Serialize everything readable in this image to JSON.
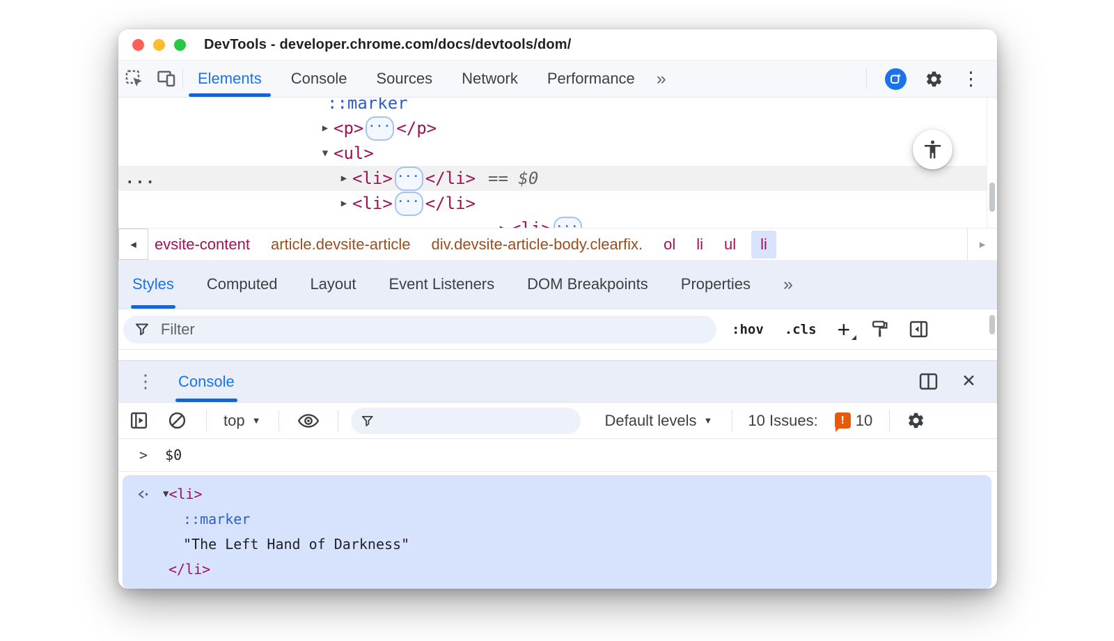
{
  "colors": {
    "accent": "#1a73e8",
    "tab_underline": "#1962d2",
    "tag_color": "#9e1355",
    "class_color": "#9a4e1f",
    "pseudo_color": "#2c5ecf",
    "issues_orange": "#e8590c",
    "selection_blue": "#d7e3fc"
  },
  "glyphs": {
    "collapsed": "▶",
    "expanded": "▼",
    "kebab": "⋮",
    "close": "✕",
    "more": "»",
    "crumb_left": "◂",
    "crumb_right": "▸",
    "prompt": ">",
    "caret_down": "▼",
    "ellipsis": "···",
    "gutter": "..."
  },
  "titlebar": {
    "title": "DevTools - developer.chrome.com/docs/devtools/dom/"
  },
  "main_tabs": {
    "items": [
      "Elements",
      "Console",
      "Sources",
      "Network",
      "Performance"
    ],
    "selected": "Elements"
  },
  "dom_tree": {
    "marker": "::marker",
    "p_open": "<p>",
    "p_close": "</p>",
    "ul_open": "<ul>",
    "li_open": "<li>",
    "li_close": "</li>",
    "selected_eq": "==",
    "selected_var": "$0"
  },
  "breadcrumbs": {
    "items": [
      "evsite-content",
      "article.devsite-article",
      "div.devsite-article-body.clearfix.",
      "ol",
      "li",
      "ul",
      "li"
    ],
    "selected_index": 6
  },
  "styles_panel": {
    "tabs": [
      "Styles",
      "Computed",
      "Layout",
      "Event Listeners",
      "DOM Breakpoints",
      "Properties"
    ],
    "selected": "Styles",
    "filter_placeholder": "Filter",
    "hov": ":hov",
    "cls": ".cls",
    "plus": "+"
  },
  "console": {
    "tab": "Console",
    "context": "top",
    "levels": "Default levels",
    "issues_label": "10 Issues:",
    "issues_count": "10",
    "echo": "$0",
    "result": {
      "open": "<li>",
      "marker": "::marker",
      "text": "\"The Left Hand of Darkness\"",
      "close": "</li>"
    }
  }
}
